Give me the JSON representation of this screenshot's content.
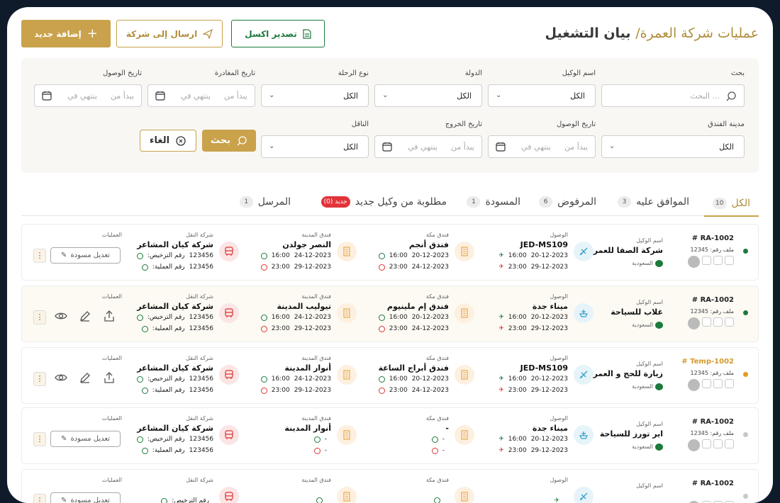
{
  "header": {
    "title": "بيان التشغيل",
    "breadcrumb": "عمليات شركة العمرة/",
    "add_button": "إضافة جديد",
    "send_button": "ارسال إلى شركة",
    "excel_button": "تصدير اكسل"
  },
  "filters": {
    "search_label": "بحث",
    "search_placeholder": "البحث ...",
    "agent_label": "اسم الوكيل",
    "agent_value": "الكل",
    "country_label": "الدولة",
    "country_value": "الكل",
    "trip_type_label": "نوع الرحلة",
    "trip_type_value": "الكل",
    "departure_label": "تاريخ المغادرة",
    "arrival_label": "تاريخ الوصول",
    "hotel_city_label": "مدينة الفندق",
    "hotel_city_value": "الكل",
    "arrival2_label": "تاريخ الوصول",
    "checkout_label": "تاريخ الخروج",
    "carrier_label": "الناقل",
    "carrier_value": "الكل",
    "date_from": "يبدأ من",
    "date_to": "ينتهي في",
    "search_button": "بحث",
    "cancel_button": "الغاء"
  },
  "tabs": [
    {
      "label": "الكل",
      "count": "10"
    },
    {
      "label": "الموافق عليه",
      "count": "3"
    },
    {
      "label": "المرفوض",
      "count": "6"
    },
    {
      "label": "المسودة",
      "count": "1"
    },
    {
      "label": "مطلوبة من وكيل جديد",
      "count": "جديد (0)"
    },
    {
      "label": "المرسل",
      "count": "1"
    }
  ],
  "labels": {
    "agent": "اسم الوكيل",
    "arrival": "الوصول",
    "makkah_hotel": "فندق مكة",
    "madinah_hotel": "فندق المدينة",
    "transport": "شركة النقل",
    "operations": "العمليات",
    "license": "رقم الترخيص:",
    "op_no": "رقم العملية:",
    "edit_draft": "تعديل مسودة",
    "country": "السعودية"
  },
  "rows": [
    {
      "id": "RA-1002 #",
      "file": "ملف رقم: 12345",
      "agent": "شركة الصفا للعمرة",
      "arrival": "JED-MS109",
      "arr_time": "16:00",
      "arr_date": "20-12-2023",
      "dep_time": "23:00",
      "dep_date": "29-12-2023",
      "makkah": "فندق أنجم",
      "mk_in": "16:00",
      "mk_in_d": "20-12-2023",
      "mk_out": "23:00",
      "mk_out_d": "24-12-2023",
      "madinah": "النصر جولدن",
      "md_in": "16:00",
      "md_in_d": "24-12-2023",
      "md_out": "23:00",
      "md_out_d": "29-12-2023",
      "transport": "شركة كيان المشاعر",
      "lic": "123456",
      "opn": "123456",
      "status_color": "#1b7a3c"
    },
    {
      "id": "RA-1002 #",
      "file": "ملف رقم: 12345",
      "agent": "غلاب للسياحة",
      "arrival": "ميناء جدة",
      "arr_time": "16:00",
      "arr_date": "20-12-2023",
      "dep_time": "23:00",
      "dep_date": "29-12-2023",
      "makkah": "فندق إم ملينيوم",
      "mk_in": "16:00",
      "mk_in_d": "20-12-2023",
      "mk_out": "23:00",
      "mk_out_d": "24-12-2023",
      "madinah": "تيوليب المدينة",
      "md_in": "16:00",
      "md_in_d": "24-12-2023",
      "md_out": "23:00",
      "md_out_d": "29-12-2023",
      "transport": "شركة كيان المشاعر",
      "lic": "123456",
      "opn": "123456",
      "status_color": "#1b7a3c"
    },
    {
      "id": "Temp-1002 #",
      "file": "ملف رقم: 12345",
      "agent": "زيارة للحج و العمرة",
      "arrival": "JED-MS109",
      "arr_time": "16:00",
      "arr_date": "20-12-2023",
      "dep_time": "23:00",
      "dep_date": "29-12-2023",
      "makkah": "فندق أبراج الساعة",
      "mk_in": "16:00",
      "mk_in_d": "20-12-2023",
      "mk_out": "23:00",
      "mk_out_d": "24-12-2023",
      "madinah": "أنوار المدينة",
      "md_in": "16:00",
      "md_in_d": "24-12-2023",
      "md_out": "23:00",
      "md_out_d": "29-12-2023",
      "transport": "شركة كيان المشاعر",
      "lic": "123456",
      "opn": "123456",
      "status_color": "#e89a1e"
    },
    {
      "id": "RA-1002 #",
      "file": "ملف رقم: 12345",
      "agent": "اير تورز للسياحة",
      "arrival": "ميناء جدة",
      "arr_time": "16:00",
      "arr_date": "20-12-2023",
      "dep_time": "23:00",
      "dep_date": "29-12-2023",
      "makkah": "-",
      "mk_in": "-",
      "mk_in_d": "",
      "mk_out": "-",
      "mk_out_d": "",
      "madinah": "أنوار المدينة",
      "md_in": "-",
      "md_in_d": "",
      "md_out": "-",
      "md_out_d": "",
      "transport": "شركة كيان المشاعر",
      "lic": "123456",
      "opn": "123456",
      "status_color": "#c8c8c8"
    },
    {
      "id": "RA-1002 #",
      "file": "",
      "agent": "",
      "arrival": "",
      "arr_time": "",
      "arr_date": "",
      "dep_time": "",
      "dep_date": "",
      "makkah": "",
      "mk_in": "",
      "mk_in_d": "",
      "mk_out": "",
      "mk_out_d": "",
      "madinah": "",
      "md_in": "",
      "md_in_d": "",
      "md_out": "",
      "md_out_d": "",
      "transport": "",
      "lic": "",
      "opn": "",
      "status_color": "#c8c8c8"
    }
  ],
  "icons": {
    "plus": "plus-icon",
    "send": "paper-plane-icon",
    "excel": "spreadsheet-icon",
    "search": "magnifier-icon",
    "calendar": "calendar-icon",
    "chevron": "chevron-down-icon",
    "edit": "pencil-icon",
    "view": "eye-icon",
    "share": "share-icon",
    "more": "kebab-icon",
    "flight": "plane-icon",
    "ship": "ship-icon",
    "hotel": "building-icon",
    "bus": "bus-icon"
  }
}
